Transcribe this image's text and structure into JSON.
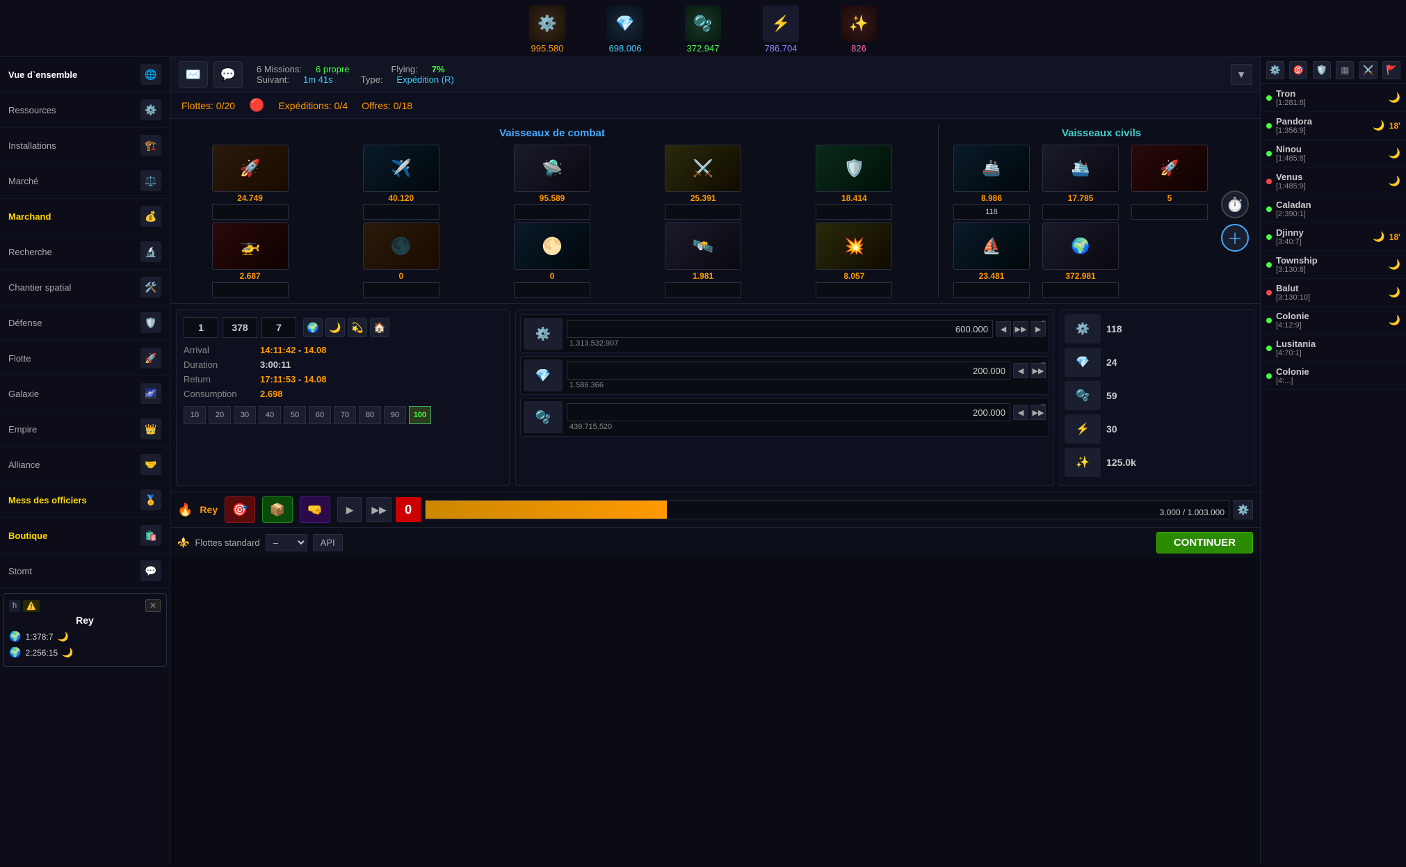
{
  "top_bar": {
    "resources": [
      {
        "name": "metal",
        "icon": "⚙️",
        "value": "995.580",
        "color_class": "orange"
      },
      {
        "name": "crystal",
        "icon": "💎",
        "value": "698.006",
        "color_class": "cyan"
      },
      {
        "name": "deuterium",
        "icon": "🫧",
        "value": "372.947",
        "color_class": "green"
      },
      {
        "name": "energy",
        "icon": "⚡",
        "value": "786.704",
        "color_class": "blue"
      },
      {
        "name": "dark_matter",
        "icon": "✨",
        "value": "826",
        "color_class": "pink"
      }
    ]
  },
  "mission_bar": {
    "missions_count": "6 Missions:",
    "missions_status": "6 propre",
    "suivant_label": "Suivant:",
    "suivant_val": "1m 41s",
    "type_label": "Type:",
    "type_val": "Expédition (R)",
    "flying_label": "Flying:",
    "flying_val": "7%"
  },
  "fleet_nav": {
    "flottes_label": "Flottes:",
    "flottes_val": "0/20",
    "expeditions_label": "Expéditions:",
    "expeditions_val": "0/4",
    "offres_label": "Offres:",
    "offres_val": "0/18"
  },
  "ships": {
    "combat_title": "Vaisseaux de combat",
    "civil_title": "Vaisseaux civils",
    "combat_ships": [
      {
        "icon": "🚀",
        "count": "24.749",
        "type": "type1"
      },
      {
        "icon": "✈️",
        "count": "40.120",
        "type": "type2"
      },
      {
        "icon": "🛸",
        "count": "95.589",
        "type": "type3"
      },
      {
        "icon": "⚔️",
        "count": "25.391",
        "type": "type4"
      },
      {
        "icon": "🛡️",
        "count": "18.414",
        "type": "type5"
      },
      {
        "icon": "🚀",
        "count": "2.687",
        "type": "type1"
      },
      {
        "icon": "✈️",
        "count": "0",
        "type": "type2"
      },
      {
        "icon": "🛸",
        "count": "0",
        "type": "type3"
      },
      {
        "icon": "⚔️",
        "count": "1.981",
        "type": "type4"
      },
      {
        "icon": "🛡️",
        "count": "8.057",
        "type": "type5"
      }
    ],
    "civil_ships": [
      {
        "icon": "🚢",
        "count": "8.986",
        "type": "type2"
      },
      {
        "icon": "🛳️",
        "count": "17.785",
        "type": "type3"
      },
      {
        "icon": "🚁",
        "count": "5",
        "type": "type6"
      },
      {
        "icon": "🚢",
        "count": "23.481",
        "type": "type2",
        "extra": ""
      },
      {
        "icon": "🛳️",
        "count": "372.981",
        "type": "type3"
      }
    ],
    "civil_special": {
      "icon": "⏱️",
      "plus": "+",
      "count": "118"
    }
  },
  "flight_panel": {
    "coords": {
      "g": "1",
      "s": "378",
      "p": "7"
    },
    "arrival": "14:11:42",
    "arrival_date": "14.08",
    "duration": "3:00:11",
    "return": "17:11:53",
    "return_date": "14.08",
    "consumption": "2.698",
    "speeds": [
      "10",
      "20",
      "30",
      "40",
      "50",
      "60",
      "70",
      "80",
      "90",
      "100"
    ],
    "active_speed": "100"
  },
  "targets": [
    {
      "amount": "600.000",
      "sub": "1.313.532.907"
    },
    {
      "amount": "200.000",
      "sub": "1.586.366"
    },
    {
      "amount": "200.000",
      "sub": "439.715.520"
    }
  ],
  "cargo": [
    {
      "icon": "⚙️",
      "count": "118"
    },
    {
      "icon": "💎",
      "count": "24"
    },
    {
      "icon": "🫧",
      "count": "59"
    },
    {
      "icon": "⚡",
      "count": "30"
    },
    {
      "icon": "✨",
      "count": "125.0k"
    }
  ],
  "bottom_action": {
    "player_name": "Rey",
    "progress_current": "3.000",
    "progress_max": "1.003.000",
    "progress_pct": 30
  },
  "fleet_standard": {
    "label": "Flottes standard",
    "dash": "–",
    "api_label": "API",
    "continue_label": "CONTINUER"
  },
  "sidebar": {
    "items": [
      {
        "label": "Vue d`ensemble",
        "active": true,
        "icon": "🌐"
      },
      {
        "label": "Ressources",
        "icon": "⚙️"
      },
      {
        "label": "Installations",
        "icon": "🏗️"
      },
      {
        "label": "Marché",
        "icon": "⚖️"
      },
      {
        "label": "Marchand",
        "yellow": true,
        "icon": "💰"
      },
      {
        "label": "Recherche",
        "icon": "🔬"
      },
      {
        "label": "Chantier spatial",
        "icon": "🛠️"
      },
      {
        "label": "Défense",
        "icon": "🛡️"
      },
      {
        "label": "Flotte",
        "icon": "🚀"
      },
      {
        "label": "Galaxie",
        "icon": "🌌"
      },
      {
        "label": "Empire",
        "icon": "👑"
      },
      {
        "label": "Alliance",
        "icon": "🤝"
      },
      {
        "label": "Mess des officiers",
        "yellow": true,
        "icon": "🏅"
      },
      {
        "label": "Boutique",
        "yellow": true,
        "icon": "🛍️"
      },
      {
        "label": "Stomt",
        "icon": "💬"
      }
    ]
  },
  "player": {
    "name": "Rey",
    "coords": [
      {
        "coord": "1:378:7",
        "has_moon": true
      },
      {
        "coord": "2:256:15",
        "has_moon": true
      }
    ]
  },
  "right_panel": {
    "planets": [
      {
        "name": "Tron",
        "coord": "[1:281:8]",
        "status": "green",
        "has_moon": true
      },
      {
        "name": "Pandora",
        "coord": "[1:356:9]",
        "status": "green",
        "has_moon": true,
        "time": "18'"
      },
      {
        "name": "Ninou",
        "coord": "[1:485:8]",
        "status": "green",
        "has_moon": true
      },
      {
        "name": "Venus",
        "coord": "[1:485:9]",
        "status": "red",
        "has_moon": true
      },
      {
        "name": "Caladan",
        "coord": "[2:390:1]",
        "status": "green",
        "has_moon": false
      },
      {
        "name": "Djinny",
        "coord": "[3:40:7]",
        "status": "green",
        "has_moon": true,
        "time": "18'"
      },
      {
        "name": "Township",
        "coord": "[3:130:8]",
        "status": "green",
        "has_moon": true
      },
      {
        "name": "Balut",
        "coord": "[3:130:10]",
        "status": "red",
        "has_moon": true
      },
      {
        "name": "Colonie",
        "coord": "[4:12:9]",
        "status": "green",
        "has_moon": true
      },
      {
        "name": "Lusitania",
        "coord": "[4:70:1]",
        "status": "green",
        "has_moon": false
      },
      {
        "name": "Colonie",
        "coord": "[4:...]",
        "status": "green",
        "has_moon": false
      }
    ]
  }
}
